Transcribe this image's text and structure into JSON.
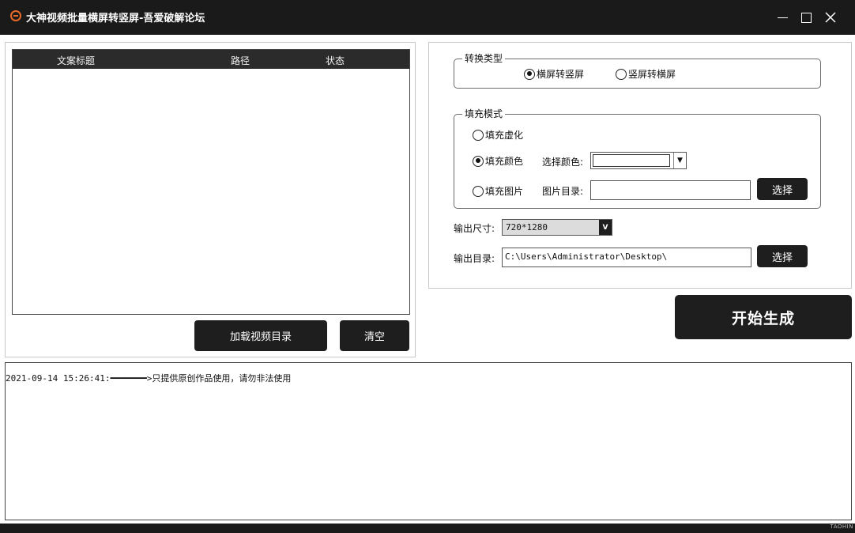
{
  "window": {
    "title": "大神视频批量横屏转竖屏-吾爱破解论坛",
    "watermark": "TAOHIN"
  },
  "list": {
    "columns": [
      "文案标题",
      "路径",
      "状态"
    ],
    "rows": []
  },
  "buttons": {
    "load_dir": "加载视频目录",
    "clear": "清空",
    "choose": "选择",
    "start": "开始生成"
  },
  "convert": {
    "legend": "转换类型",
    "options": [
      {
        "label": "横屏转竖屏",
        "selected": true
      },
      {
        "label": "竖屏转横屏",
        "selected": false
      }
    ]
  },
  "fill": {
    "legend": "填充模式",
    "blur_label": "填充虚化",
    "blur_selected": false,
    "color_label": "填充颜色",
    "color_selected": true,
    "choose_color_label": "选择颜色:",
    "color_value": "",
    "image_label": "填充图片",
    "image_selected": false,
    "image_dir_label": "图片目录:",
    "image_dir_value": ""
  },
  "output": {
    "size_label": "输出尺寸:",
    "size_value": "720*1280",
    "dir_label": "输出目录:",
    "dir_value": "C:\\Users\\Administrator\\Desktop\\"
  },
  "log": {
    "lines": [
      "2021-09-14 15:26:41:━━━━━━━>只提供原创作品使用，请勿非法使用"
    ]
  },
  "icons": {
    "app": "app-logo-icon",
    "minimize": "minimize-icon",
    "maximize": "maximize-icon",
    "close": "close-icon",
    "dropdown": "chevron-down-icon"
  }
}
